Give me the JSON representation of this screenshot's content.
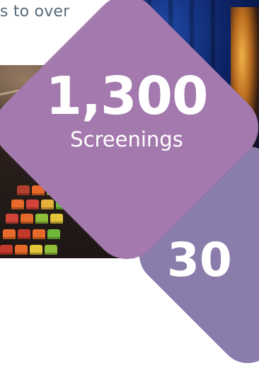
{
  "intro": {
    "text": "s to over"
  },
  "stats": [
    {
      "value": "1,300",
      "label": "Screenings",
      "color": "#a379ae"
    },
    {
      "value": "30 ",
      "label": "",
      "color": "#8a7cab"
    }
  ],
  "images": {
    "left": "cinema-seats-photo",
    "right": "stage-performer-photo"
  }
}
